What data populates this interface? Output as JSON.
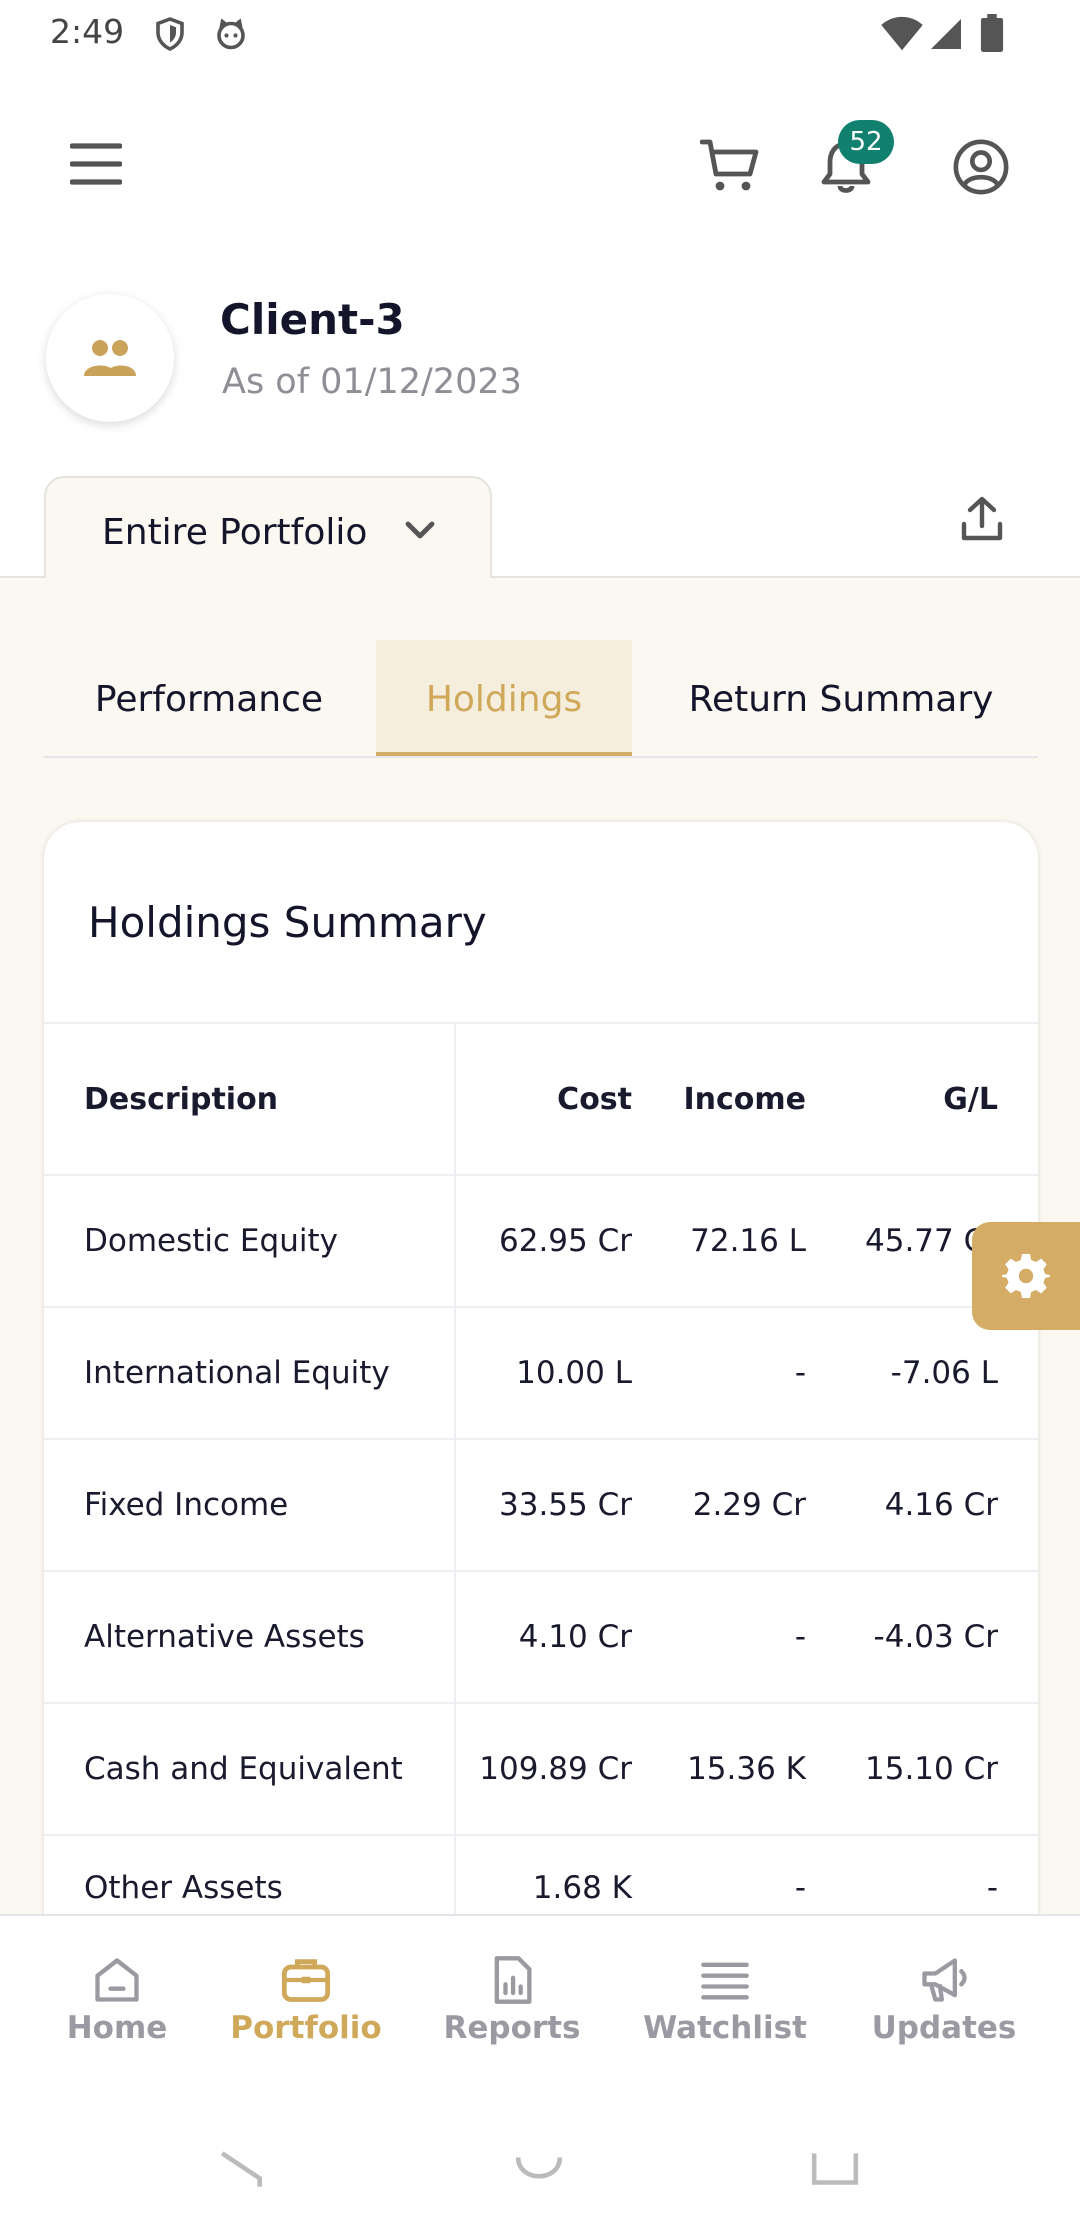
{
  "status_bar": {
    "time": "2:49"
  },
  "header": {
    "notification_count": "52"
  },
  "client": {
    "name": "Client-3",
    "as_of": "As of 01/12/2023"
  },
  "portfolio_selector": {
    "value": "Entire Portfolio"
  },
  "tabs": [
    {
      "label": "Performance",
      "active": false
    },
    {
      "label": "Holdings",
      "active": true
    },
    {
      "label": "Return Summary",
      "active": false
    }
  ],
  "holdings": {
    "title": "Holdings Summary",
    "columns": [
      "Description",
      "Cost",
      "Income",
      "G/L"
    ],
    "rows": [
      [
        "Domestic Equity",
        "62.95 Cr",
        "72.16 L",
        "45.77 Cr"
      ],
      [
        "International Equity",
        "10.00 L",
        "-",
        "-7.06 L"
      ],
      [
        "Fixed Income",
        "33.55 Cr",
        "2.29 Cr",
        "4.16 Cr"
      ],
      [
        "Alternative Assets",
        "4.10 Cr",
        "-",
        "-4.03 Cr"
      ],
      [
        "Cash and Equivalent",
        "109.89 Cr",
        "15.36 K",
        "15.10 Cr"
      ],
      [
        "Other Assets",
        "1.68 K",
        "-",
        "-"
      ]
    ]
  },
  "bottom_nav": [
    {
      "label": "Home",
      "icon": "home-icon"
    },
    {
      "label": "Portfolio",
      "icon": "briefcase-icon",
      "active": true
    },
    {
      "label": "Reports",
      "icon": "report-icon"
    },
    {
      "label": "Watchlist",
      "icon": "list-icon"
    },
    {
      "label": "Updates",
      "icon": "megaphone-icon"
    }
  ],
  "colors": {
    "accent": "#d1ad66",
    "badge": "#12806e",
    "cream": "#fbf8f1"
  }
}
